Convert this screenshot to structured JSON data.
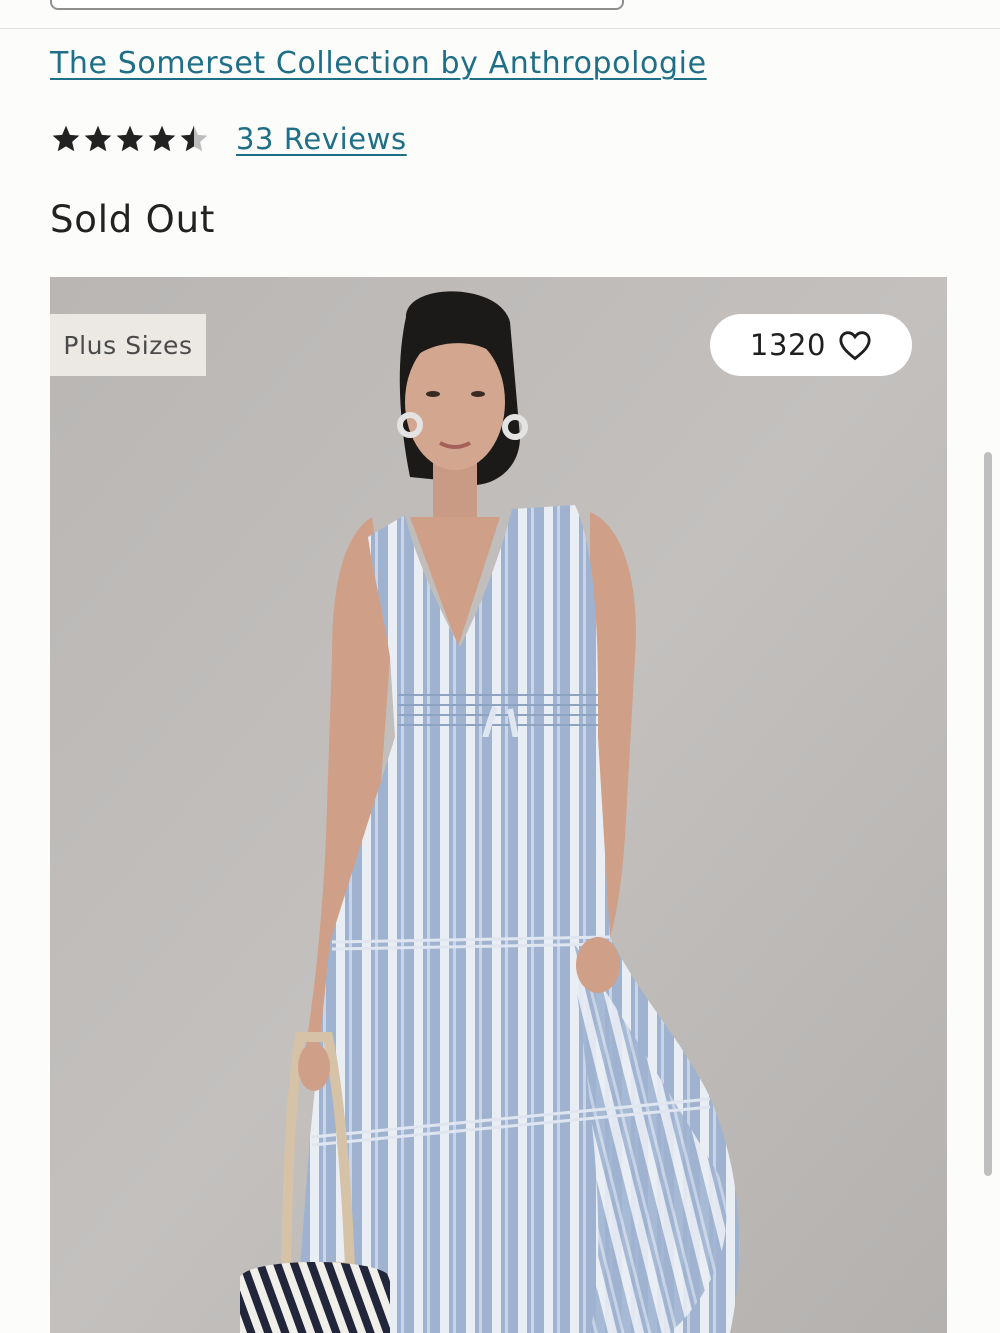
{
  "product": {
    "brand_link": "The Somerset Collection by Anthropologie",
    "rating": 4.5,
    "rating_max": 5,
    "reviews_link": "33 Reviews",
    "status": "Sold Out"
  },
  "gallery": {
    "badge": "Plus Sizes",
    "favorites_count": "1320"
  },
  "colors": {
    "link": "#1f6f88",
    "star": "#222222",
    "text": "#222222",
    "background": "#fcfcfa"
  },
  "icons": {
    "rating": "star-icon",
    "favorite": "heart-icon"
  }
}
